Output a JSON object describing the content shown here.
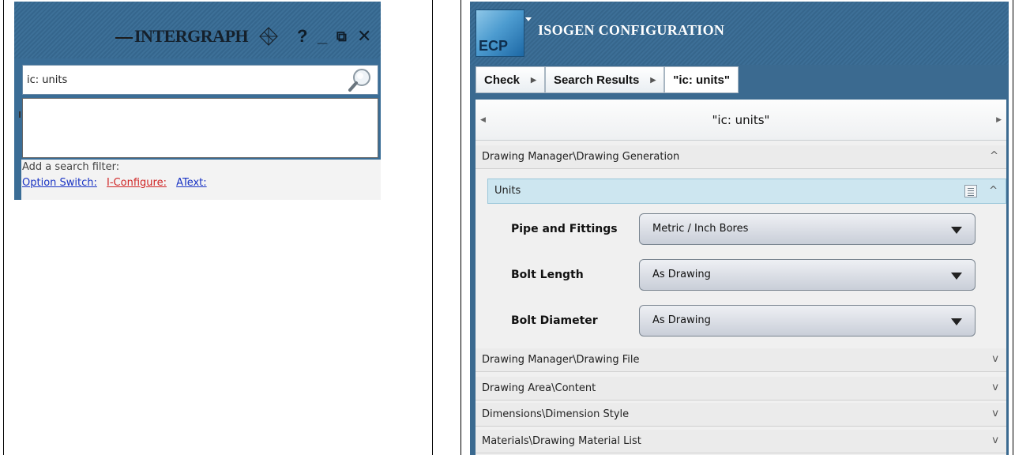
{
  "left": {
    "brand": "INTERGRAPH",
    "window_controls": {
      "help": "?",
      "minimize": "_",
      "restore": "⧉",
      "close": "✕"
    },
    "search": {
      "value": "ic: units",
      "icon": "magnifier-icon"
    },
    "filter": {
      "label": "Add a search filter:",
      "links": [
        "Option Switch:",
        "I-Configure:",
        "AText:"
      ]
    }
  },
  "right": {
    "logo_text": "ECP",
    "title": "ISOGEN CONFIGURATION",
    "breadcrumb": [
      "Check",
      "Search Results",
      "\"ic: units\""
    ],
    "scroll_title": "\"ic: units\"",
    "sections": [
      {
        "label": "Drawing Manager\\Drawing Generation",
        "chevron": "^"
      },
      {
        "label": "Drawing Manager\\Drawing File",
        "chevron": "v"
      },
      {
        "label": "Drawing Area\\Content",
        "chevron": "v"
      },
      {
        "label": "Dimensions\\Dimension Style",
        "chevron": "v"
      },
      {
        "label": "Materials\\Drawing Material List",
        "chevron": "v"
      }
    ],
    "subsection": {
      "label": "Units",
      "chevron": "^"
    },
    "fields": [
      {
        "label": "Pipe and Fittings",
        "value": "Metric / Inch Bores"
      },
      {
        "label": "Bolt Length",
        "value": "As Drawing"
      },
      {
        "label": "Bolt Diameter",
        "value": "As Drawing"
      }
    ]
  },
  "colors": {
    "header_blue": "#3b6a90",
    "link_blue": "#1a34c4",
    "link_red": "#d02626",
    "sub_header": "#cde6f0"
  }
}
